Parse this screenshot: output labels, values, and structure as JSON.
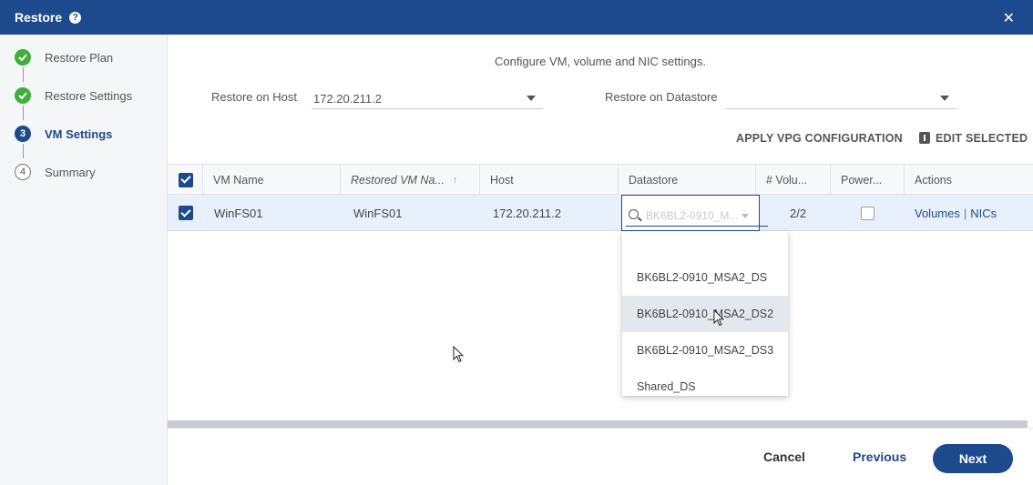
{
  "window": {
    "title": "Restore"
  },
  "steps": [
    {
      "label": "Restore Plan",
      "state": "done",
      "marker": ""
    },
    {
      "label": "Restore Settings",
      "state": "done",
      "marker": ""
    },
    {
      "label": "VM Settings",
      "state": "active",
      "marker": "3"
    },
    {
      "label": "Summary",
      "state": "pending",
      "marker": "4"
    }
  ],
  "main": {
    "subtitle": "Configure VM, volume and NIC settings.",
    "restore_host_label": "Restore on Host",
    "restore_host_value": "172.20.211.2",
    "restore_datastore_label": "Restore on Datastore",
    "restore_datastore_value": "",
    "apply_vpg": "APPLY VPG CONFIGURATION",
    "edit_selected": "EDIT SELECTED"
  },
  "table": {
    "columns": [
      "VM Name",
      "Restored VM Na...",
      "Host",
      "Datastore",
      "# Volu...",
      "Power...",
      "Actions"
    ],
    "row": {
      "vm_name": "WinFS01",
      "restored_name": "WinFS01",
      "host": "172.20.211.2",
      "volumes": "2/2",
      "actions_volumes": "Volumes",
      "actions_sep": "|",
      "actions_nics": "NICs"
    }
  },
  "datastore_dropdown": {
    "search_ghost": "BK6BL2-0910_M...",
    "options": [
      "BK6BL2-0910_MSA2_DS",
      "BK6BL2-0910_MSA2_DS2",
      "BK6BL2-0910_MSA2_DS3",
      "Shared_DS"
    ],
    "hovered_index": 1
  },
  "footer": {
    "cancel": "Cancel",
    "previous": "Previous",
    "next": "Next"
  },
  "colors": {
    "brand": "#1d4a8c",
    "success": "#3fae3a"
  }
}
